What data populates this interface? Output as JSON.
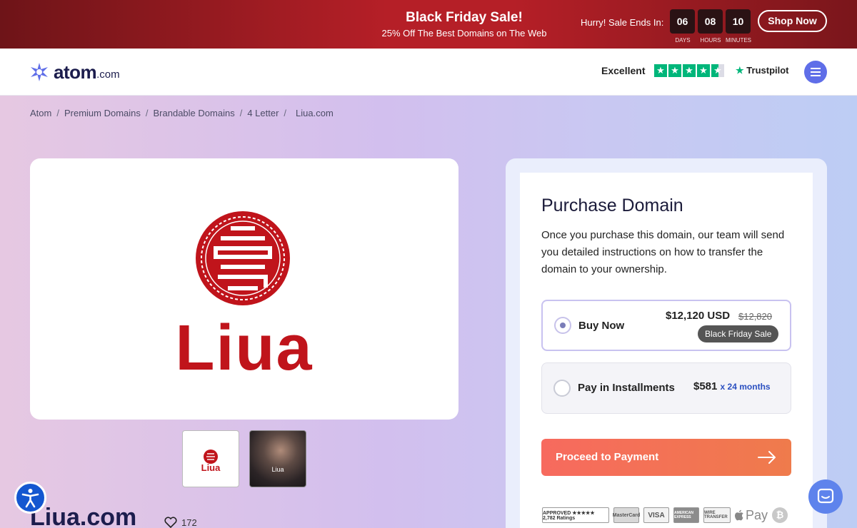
{
  "promo": {
    "title": "Black Friday Sale!",
    "subtitle": "25% Off The Best Domains on The Web",
    "hurry": "Hurry! Sale Ends In:",
    "countdown": [
      {
        "value": "06",
        "label": "DAYS"
      },
      {
        "value": "08",
        "label": "HOURS"
      },
      {
        "value": "10",
        "label": "MINUTES"
      }
    ],
    "cta": "Shop Now"
  },
  "header": {
    "logo_name": "atom",
    "logo_suffix": ".com",
    "rating_text": "Excellent",
    "rating_stars": 4.5,
    "trustpilot": "Trustpilot",
    "brand_color": "#5f6ee8"
  },
  "breadcrumbs": [
    "Atom",
    "Premium Domains",
    "Brandable Domains",
    "4 Letter",
    "Liua.com"
  ],
  "preview": {
    "brand_word": "Liua",
    "brand_color": "#c0141b",
    "thumbnails": [
      {
        "label": "Liua",
        "kind": "logo"
      },
      {
        "label": "Liua",
        "kind": "photo"
      }
    ]
  },
  "domain": {
    "name": "Liua.com",
    "likes": "172"
  },
  "purchase": {
    "title": "Purchase Domain",
    "description": "Once you purchase this domain, our team will send you detailed instructions on how to transfer the domain to your ownership.",
    "options": [
      {
        "label": "Buy Now",
        "price": "$12,120 USD",
        "old_price": "$12,820",
        "badge": "Black Friday Sale",
        "selected": true
      },
      {
        "label": "Pay in Installments",
        "price": "$581",
        "suffix": "x 24 months",
        "selected": false
      }
    ],
    "cta": "Proceed to Payment",
    "cta_color": "#f76a5e",
    "payment_methods": [
      {
        "name": "APPROVED ★★★★★ 2,782 Ratings"
      },
      {
        "name": "MasterCard"
      },
      {
        "name": "VISA"
      },
      {
        "name": "AMERICAN EXPRESS"
      },
      {
        "name": "WIRE TRANSFER"
      },
      {
        "name": "Pay"
      },
      {
        "name": "Bitcoin"
      }
    ]
  }
}
